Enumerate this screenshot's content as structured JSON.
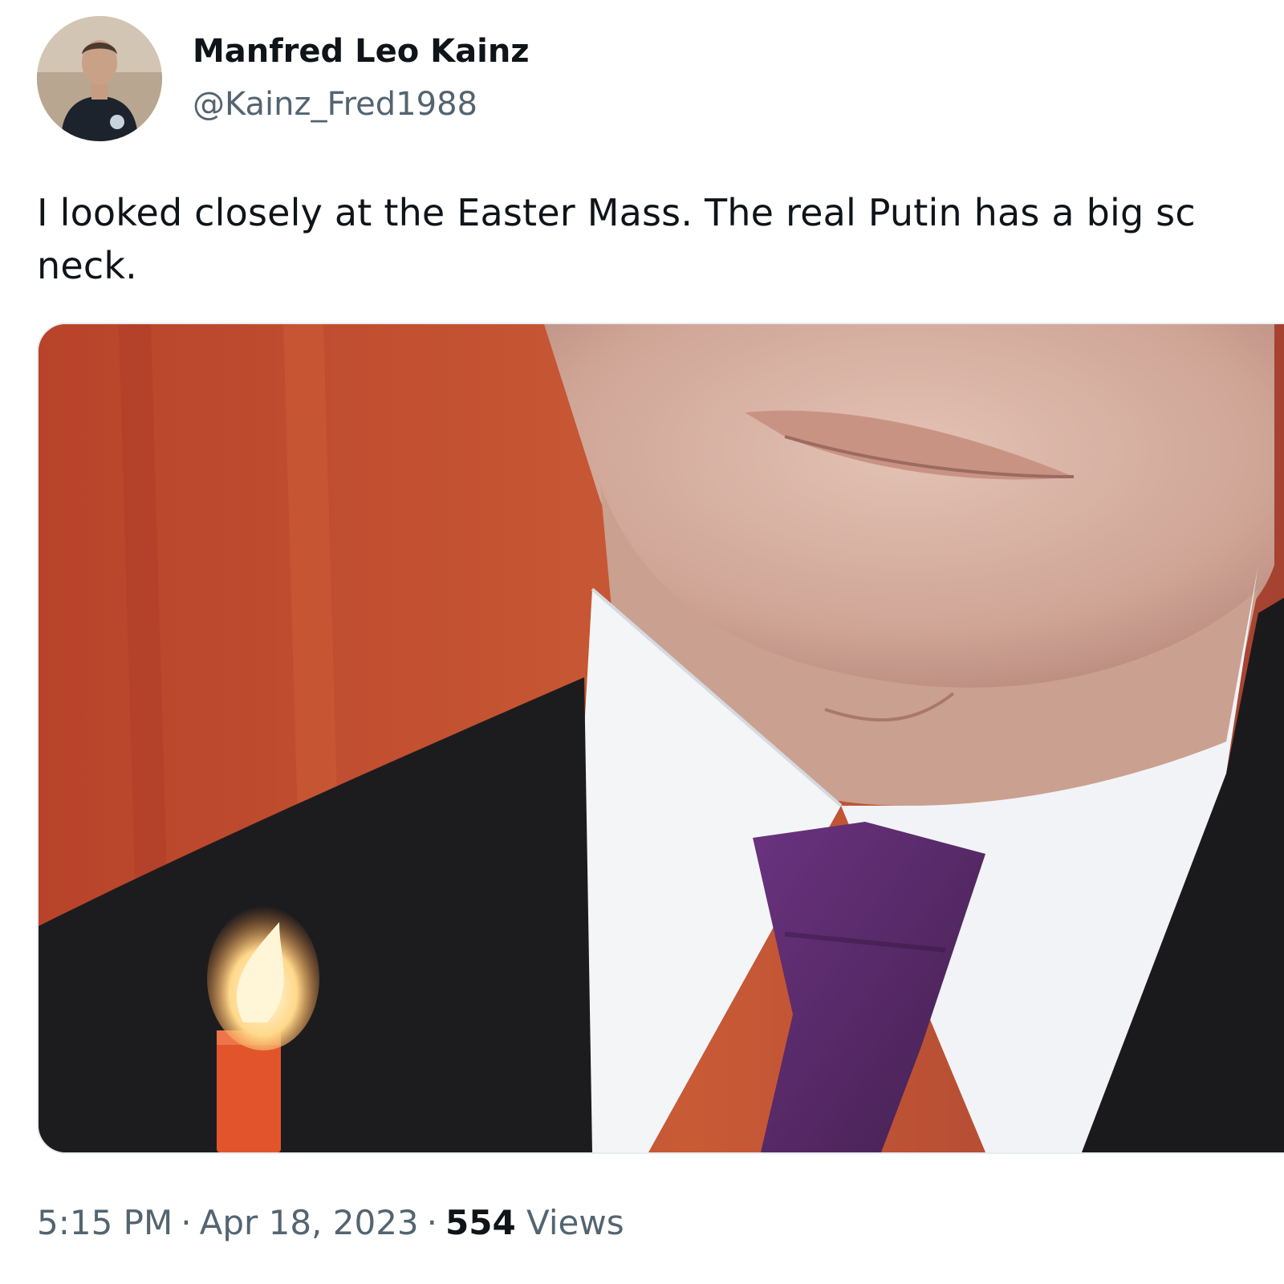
{
  "author": {
    "display_name": "Manfred Leo Kainz",
    "handle": "@Kainz_Fred1988",
    "avatar_icon": "profile-photo"
  },
  "tweet": {
    "text_lines": [
      "I looked closely at the Easter Mass. The real Putin has a big sc",
      "neck."
    ]
  },
  "media": {
    "type": "photo",
    "icon": "photo-candle-suit-tie"
  },
  "meta": {
    "time": "5:15 PM",
    "separator": "·",
    "date": "Apr 18, 2023",
    "views_count": "554",
    "views_label": "Views"
  },
  "colors": {
    "text_primary": "#0f1419",
    "text_secondary": "#536471",
    "media_background_red": "#c4502d",
    "tie_purple": "#5a2a6e",
    "suit_dark": "#1b1b1d"
  }
}
